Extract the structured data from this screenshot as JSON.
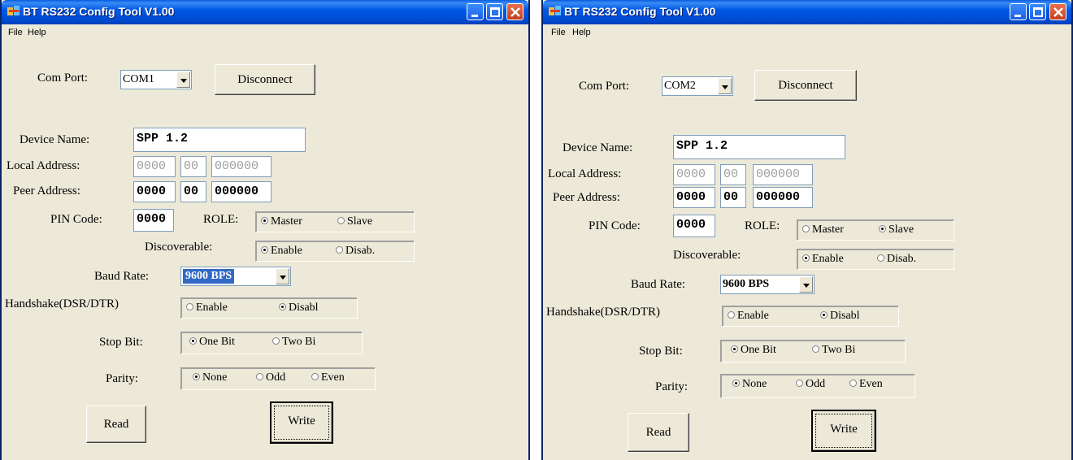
{
  "left": {
    "title": "BT RS232 Config Tool  V1.00",
    "menu": {
      "file": "File",
      "help": "Help"
    },
    "com_port_label": "Com Port:",
    "com_port_value": "COM1",
    "disconnect_label": "Disconnect",
    "device_name_label": "Device Name:",
    "device_name_value": "SPP 1.2",
    "local_address_label": "Local Address:",
    "local_address": [
      "0000",
      "00",
      "000000"
    ],
    "peer_address_label": "Peer Address:",
    "peer_address": [
      "0000",
      "00",
      "000000"
    ],
    "pin_code_label": "PIN Code:",
    "pin_code_value": "0000",
    "role_label": "ROLE:",
    "role_master": "Master",
    "role_slave": "Slave",
    "role_selected": "Master",
    "discoverable_label": "Discoverable:",
    "disc_enable": "Enable",
    "disc_disable": "Disab.",
    "baud_rate_label": "Baud Rate:",
    "baud_rate_value": "9600 BPS",
    "handshake_label": "Handshake(DSR/DTR)",
    "hs_enable": "Enable",
    "hs_disable": "Disabl",
    "stop_bit_label": "Stop Bit:",
    "stop_one": "One Bit",
    "stop_two": "Two Bi",
    "parity_label": "Parity:",
    "parity_none": "None",
    "parity_odd": "Odd",
    "parity_even": "Even",
    "read_label": "Read",
    "write_label": "Write"
  },
  "right": {
    "title": "BT RS232 Config Tool  V1.00",
    "menu": {
      "file": "File",
      "help": "Help"
    },
    "com_port_label": "Com Port:",
    "com_port_value": "COM2",
    "disconnect_label": "Disconnect",
    "device_name_label": "Device Name:",
    "device_name_value": "SPP 1.2",
    "local_address_label": "Local Address:",
    "local_address": [
      "0000",
      "00",
      "000000"
    ],
    "peer_address_label": "Peer Address:",
    "peer_address": [
      "0000",
      "00",
      "000000"
    ],
    "pin_code_label": "PIN Code:",
    "pin_code_value": "0000",
    "role_label": "ROLE:",
    "role_master": "Master",
    "role_slave": "Slave",
    "role_selected": "Slave",
    "discoverable_label": "Discoverable:",
    "disc_enable": "Enable",
    "disc_disable": "Disab.",
    "baud_rate_label": "Baud Rate:",
    "baud_rate_value": "9600 BPS",
    "handshake_label": "Handshake(DSR/DTR)",
    "hs_enable": "Enable",
    "hs_disable": "Disabl",
    "stop_bit_label": "Stop Bit:",
    "stop_one": "One Bit",
    "stop_two": "Two Bi",
    "parity_label": "Parity:",
    "parity_none": "None",
    "parity_odd": "Odd",
    "parity_even": "Even",
    "read_label": "Read",
    "write_label": "Write"
  }
}
